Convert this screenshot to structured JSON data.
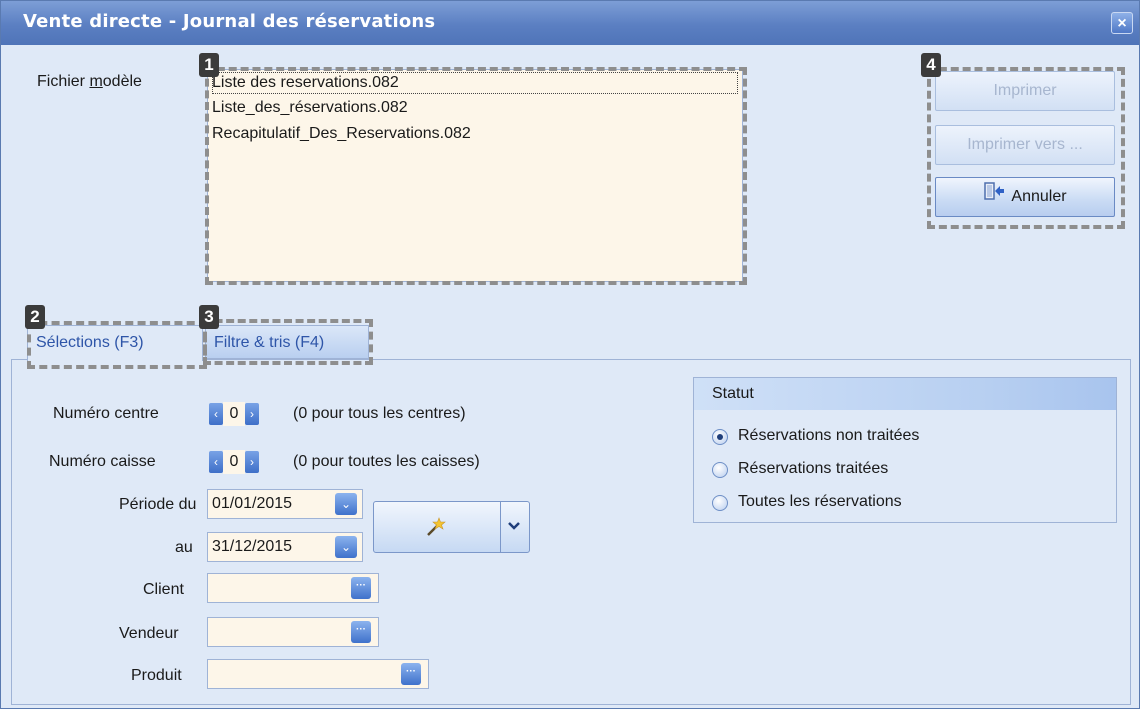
{
  "window": {
    "title": "Vente directe - Journal des réservations",
    "close_glyph": "×"
  },
  "template_file": {
    "label_prefix": "Fichier ",
    "label_accel": "m",
    "label_suffix": "odèle",
    "items": [
      "Liste des reservations.082",
      "Liste_des_réservations.082",
      "Recapitulatif_Des_Reservations.082"
    ]
  },
  "markers": [
    "1",
    "2",
    "3",
    "4"
  ],
  "buttons": {
    "print": "Imprimer",
    "print_to": "Imprimer vers ...",
    "cancel": "Annuler"
  },
  "tabs": {
    "selections": "Sélections (F3)",
    "filter_sort": "Filtre & tris (F4)"
  },
  "form": {
    "centre_label": "Numéro centre",
    "centre_value": "0",
    "centre_hint": "(0 pour tous les centres)",
    "caisse_label": "Numéro caisse",
    "caisse_value": "0",
    "caisse_hint": "(0 pour toutes les caisses)",
    "period_from_label": "Période du",
    "period_from_value": "01/01/2015",
    "period_to_label": "au",
    "period_to_value": "31/12/2015",
    "client_label": "Client",
    "client_value": "",
    "vendeur_label": "Vendeur",
    "vendeur_value": "",
    "produit_label": "Produit",
    "produit_value": ""
  },
  "statut": {
    "title": "Statut",
    "options": [
      "Réservations non traitées",
      "Réservations traitées",
      "Toutes les réservations"
    ],
    "selected_index": 0
  },
  "icons": {
    "spin_left": "‹",
    "spin_right": "›",
    "dropdown": "⌄",
    "ellipsis": "···",
    "wand": "magic-wand-icon",
    "exit": "exit-door-icon"
  },
  "colors": {
    "title_bar": "#5b7fc2",
    "tab_text": "#2e55a8",
    "field_bg": "#fdf6e9"
  }
}
